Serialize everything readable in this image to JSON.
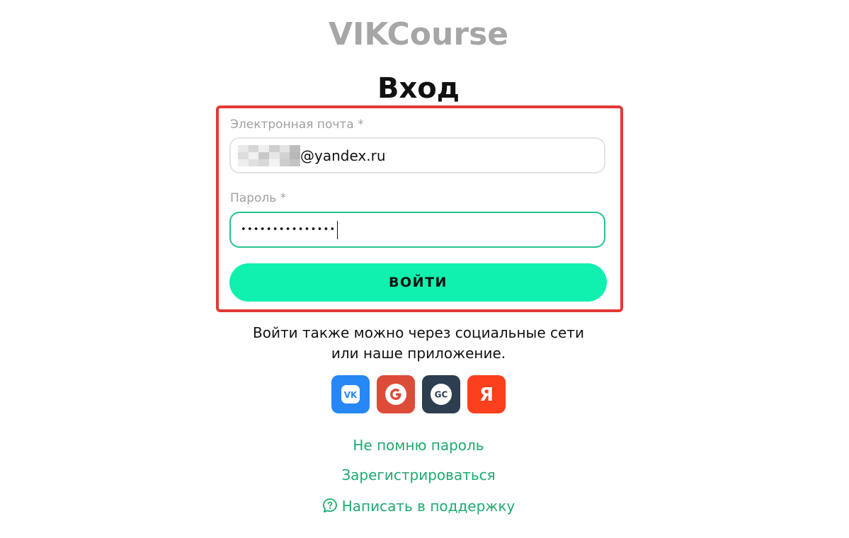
{
  "brand": {
    "logo_text": "VIKCourse"
  },
  "login": {
    "title": "Вход",
    "email_label": "Электронная почта *",
    "email_value": "@yandex.ru",
    "password_label": "Пароль *",
    "password_value": "•••••••••••••••",
    "submit_label": "ВОЙТИ"
  },
  "social": {
    "line1": "Войти также можно через социальные сети",
    "line2": "или наше приложение.",
    "buttons": [
      {
        "name": "vk",
        "glyph": "VK",
        "color": "#2787f5"
      },
      {
        "name": "google",
        "glyph": "G",
        "color": "#dd4b39"
      },
      {
        "name": "getcourse",
        "glyph": "GC",
        "color": "#2c3e50"
      },
      {
        "name": "yandex",
        "glyph": "Я",
        "color": "#fc3f1d"
      }
    ]
  },
  "links": {
    "forgot_password": "Не помню пароль",
    "register": "Зарегистрироваться",
    "support": "Написать в поддержку"
  },
  "colors": {
    "accent": "#10f0ae",
    "link": "#1faa6f",
    "focus_border": "#24c48b",
    "highlight_frame": "#e53935"
  }
}
